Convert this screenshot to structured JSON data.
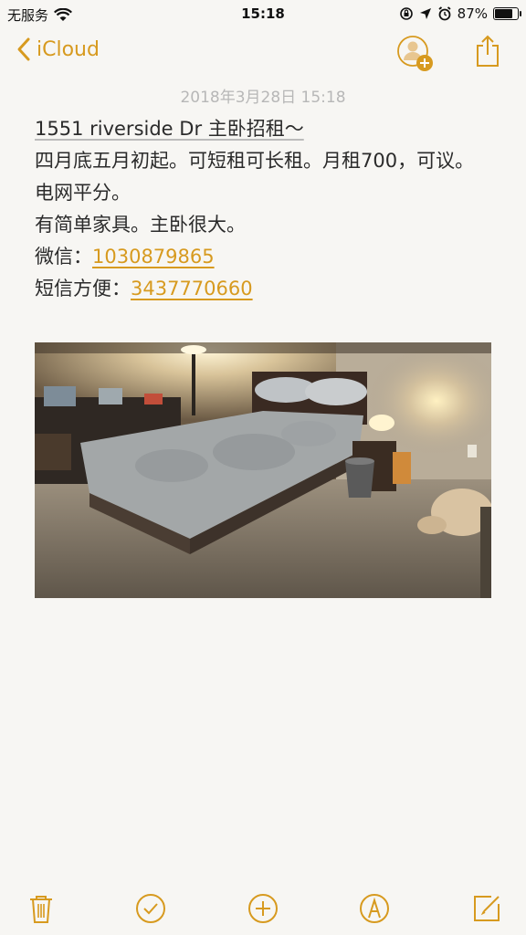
{
  "status_bar": {
    "carrier": "无服务",
    "time": "15:18",
    "battery_pct": "87%",
    "battery_level": 0.87
  },
  "nav": {
    "back_label": "iCloud",
    "icons": [
      "chevron-left-icon",
      "person-add-icon",
      "share-icon"
    ]
  },
  "note": {
    "timestamp": "2018年3月28日 15:18",
    "title": "1551 riverside Dr 主卧招租～",
    "line1": "四月底五月初起。可短租可长租。月租700，可议。",
    "line2": "电网平分。",
    "line3": "有简单家具。主卧很大。",
    "wechat_label": "微信：",
    "wechat_value": "1030879865",
    "sms_label": "短信方便：",
    "sms_value": "3437770660"
  },
  "photo": {
    "icon": "bedroom-photo"
  },
  "toolbar": {
    "icons": [
      "trash-icon",
      "checklist-icon",
      "add-icon",
      "markup-icon",
      "compose-icon"
    ]
  },
  "colors": {
    "accent": "#d79a1f",
    "background": "#f7f6f3",
    "timestamp": "#b7b7b7"
  }
}
